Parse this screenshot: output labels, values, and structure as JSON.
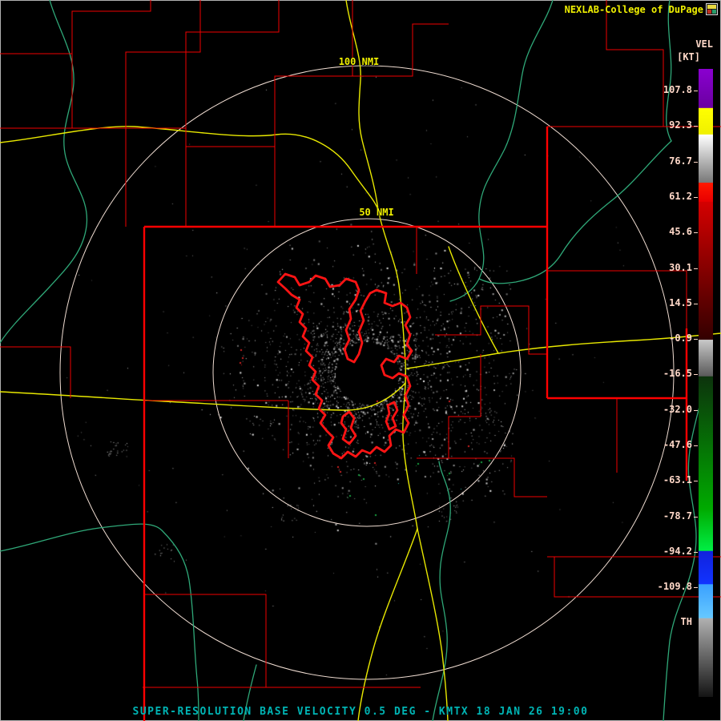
{
  "header": {
    "brand": "NEXLAB-College of DuPage"
  },
  "colorbar": {
    "title": "VEL",
    "units": "[KT]",
    "threshold_label": "TH",
    "ticks": [
      "107.8",
      "92.3",
      "76.7",
      "61.2",
      "45.6",
      "30.1",
      "14.5",
      "-0.9",
      "-16.5",
      "-32.0",
      "-47.6",
      "-63.1",
      "-78.7",
      "-94.2",
      "-109.8"
    ],
    "stops": [
      {
        "p": 0.0,
        "c": "#8a00d0"
      },
      {
        "p": 0.062,
        "c": "#6a00a0"
      },
      {
        "p": 0.0625,
        "c": "#ffff00"
      },
      {
        "p": 0.104,
        "c": "#f0f000"
      },
      {
        "p": 0.105,
        "c": "#ffffff"
      },
      {
        "p": 0.181,
        "c": "#787878"
      },
      {
        "p": 0.1815,
        "c": "#ff1800"
      },
      {
        "p": 0.211,
        "c": "#e80000"
      },
      {
        "p": 0.212,
        "c": "#d40000"
      },
      {
        "p": 0.431,
        "c": "#330000"
      },
      {
        "p": 0.4315,
        "c": "#c8c8c8"
      },
      {
        "p": 0.489,
        "c": "#5a5a5a"
      },
      {
        "p": 0.49,
        "c": "#0c330c"
      },
      {
        "p": 0.7,
        "c": "#00aa00"
      },
      {
        "p": 0.767,
        "c": "#00ee44"
      },
      {
        "p": 0.768,
        "c": "#1122dd"
      },
      {
        "p": 0.82,
        "c": "#1133ff"
      },
      {
        "p": 0.821,
        "c": "#3aa0ff"
      },
      {
        "p": 0.874,
        "c": "#66c8ff"
      },
      {
        "p": 0.875,
        "c": "#b0b0b0"
      },
      {
        "p": 1.0,
        "c": "#141414"
      }
    ]
  },
  "map": {
    "ring_labels": {
      "outer": "100 NMI",
      "inner": "50 NMI"
    }
  },
  "footer": {
    "title": "SUPER-RESOLUTION BASE VELOCITY 0.5 DEG - KMTX 18 JAN 26 19:00"
  },
  "colors": {
    "background": "#000000",
    "county_border": "#f00000",
    "state_border": "#ff0000",
    "lake_outline": "#ff1414",
    "highway": "#e8e800",
    "river": "#2fa878",
    "range_ring": "#f0ddd2",
    "ring_label": "#f0f000",
    "brand_text": "#f0f000",
    "tick_text": "#ffd8c8",
    "footer_text": "#00b4b4"
  }
}
